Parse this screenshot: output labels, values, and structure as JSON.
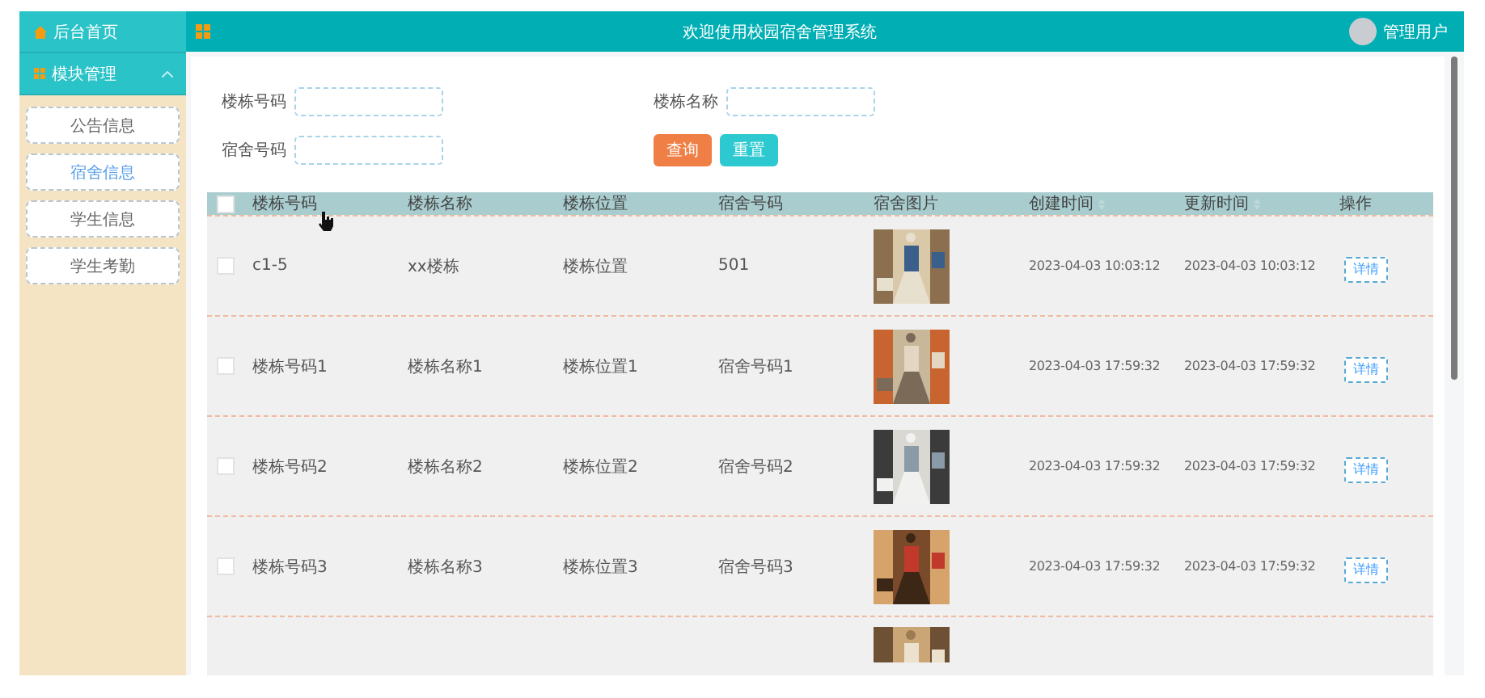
{
  "sidebar": {
    "home": "后台首页",
    "group": {
      "label": "模块管理",
      "expanded": true
    },
    "items": [
      {
        "label": "公告信息",
        "selected": false
      },
      {
        "label": "宿舍信息",
        "selected": true
      },
      {
        "label": "学生信息",
        "selected": false
      },
      {
        "label": "学生考勤",
        "selected": false
      }
    ]
  },
  "header": {
    "title": "欢迎使用校园宿舍管理系统",
    "user": "管理用户"
  },
  "search": {
    "fields": [
      {
        "label": "楼栋号码"
      },
      {
        "label": "楼栋名称"
      },
      {
        "label": "宿舍号码"
      }
    ],
    "buttons": [
      {
        "label": "查询",
        "kind": "primary"
      },
      {
        "label": "重置",
        "kind": "secondary"
      }
    ]
  },
  "table": {
    "all_checked": false,
    "columns": [
      {
        "label": "楼栋号码",
        "sortable": false
      },
      {
        "label": "楼栋名称",
        "sortable": false
      },
      {
        "label": "楼栋位置",
        "sortable": false
      },
      {
        "label": "宿舍号码",
        "sortable": false
      },
      {
        "label": "宿舍图片",
        "sortable": false
      },
      {
        "label": "创建时间",
        "sortable": true
      },
      {
        "label": "更新时间",
        "sortable": true
      },
      {
        "label": "操作",
        "sortable": false
      }
    ],
    "rows": [
      {
        "kind": "full",
        "checked": false,
        "cells": [
          "c1-5",
          "xx楼栋",
          "楼栋位置",
          "501"
        ],
        "picture": {
          "kind": "picture"
        },
        "created": "2023-04-03 10:03:12",
        "updated": "2023-04-03 10:03:12",
        "action": "详情"
      },
      {
        "kind": "full",
        "checked": false,
        "cells": [
          "楼栋号码1",
          "楼栋名称1",
          "楼栋位置1",
          "宿舍号码1"
        ],
        "picture": {
          "kind": "picture"
        },
        "created": "2023-04-03 17:59:32",
        "updated": "2023-04-03 17:59:32",
        "action": "详情"
      },
      {
        "kind": "full",
        "checked": false,
        "cells": [
          "楼栋号码2",
          "楼栋名称2",
          "楼栋位置2",
          "宿舍号码2"
        ],
        "picture": {
          "kind": "picture"
        },
        "created": "2023-04-03 17:59:32",
        "updated": "2023-04-03 17:59:32",
        "action": "详情"
      },
      {
        "kind": "full",
        "checked": false,
        "cells": [
          "楼栋号码3",
          "楼栋名称3",
          "楼栋位置3",
          "宿舍号码3"
        ],
        "picture": {
          "kind": "picture"
        },
        "created": "2023-04-03 17:59:32",
        "updated": "2023-04-03 17:59:32",
        "action": "详情"
      },
      {
        "kind": "partial",
        "picture": {
          "kind": "picture"
        }
      }
    ]
  }
}
